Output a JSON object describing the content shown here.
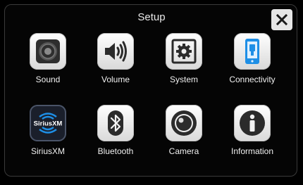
{
  "header": {
    "title": "Setup",
    "close_icon": "close-icon"
  },
  "menu": {
    "items": [
      {
        "label": "Sound",
        "icon": "speaker-icon"
      },
      {
        "label": "Volume",
        "icon": "volume-icon"
      },
      {
        "label": "System",
        "icon": "gear-icon"
      },
      {
        "label": "Connectivity",
        "icon": "phone-usb-icon"
      },
      {
        "label": "SiriusXM",
        "icon": "siriusxm-logo-icon",
        "logo_text": "SiriusXM"
      },
      {
        "label": "Bluetooth",
        "icon": "bluetooth-icon"
      },
      {
        "label": "Camera",
        "icon": "camera-icon"
      },
      {
        "label": "Information",
        "icon": "info-icon"
      }
    ]
  },
  "colors": {
    "background": "#000000",
    "tile_light": "#ffffff",
    "icon_dark": "#2b2b2b",
    "accent_blue": "#1e90ff"
  }
}
